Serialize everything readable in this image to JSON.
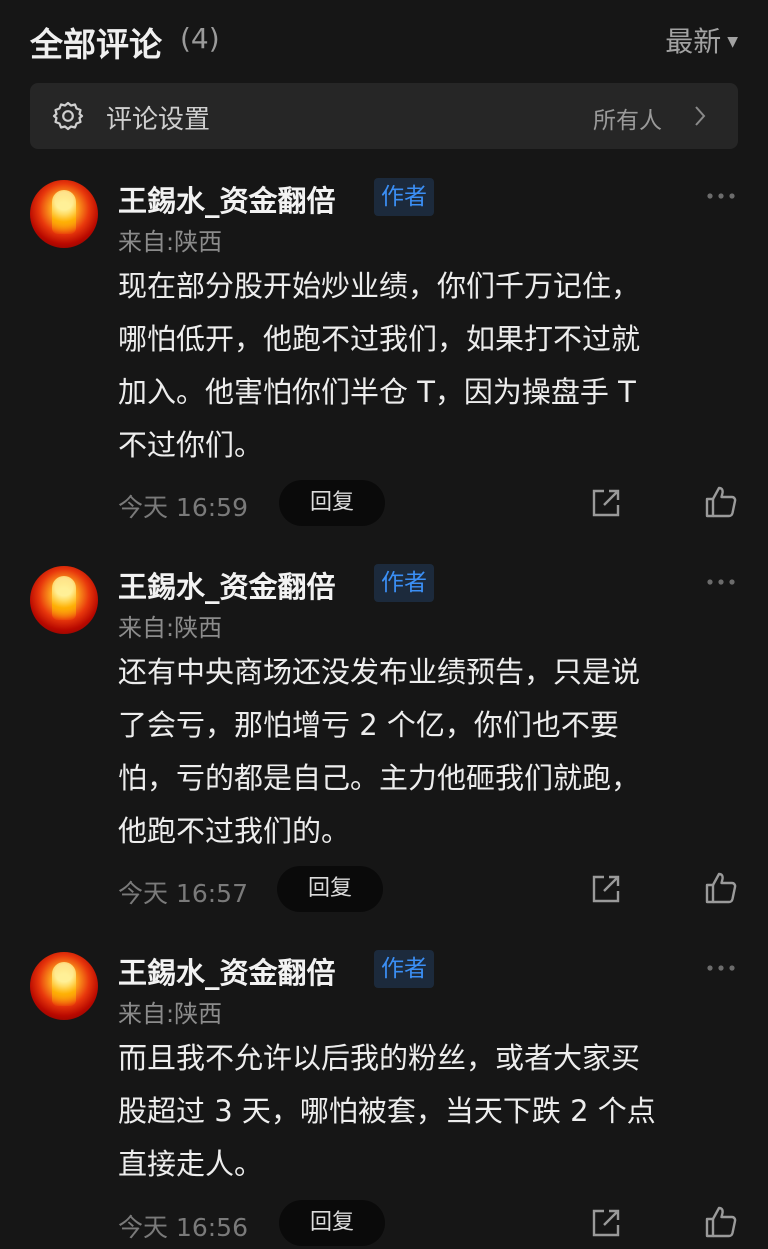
{
  "header": {
    "title": "全部评论",
    "count": "(4)",
    "sort_label": "最新",
    "sort_icon": "triangle-down-icon"
  },
  "settings": {
    "label": "评论设置",
    "value": "所有人",
    "icon": "gear-icon",
    "chevron_icon": "chevron-right-icon"
  },
  "comments": [
    {
      "author": "王錫水_资金翻倍",
      "badge": "作者",
      "location": "来自:陕西",
      "lines": [
        "现在部分股开始炒业绩，你们千万记住，",
        "哪怕低开，他跑不过我们，如果打不过就",
        "加入。他害怕你们半仓 T，因为操盘手 T",
        "不过你们。"
      ],
      "time": "今天 16:59",
      "reply_label": "回复"
    },
    {
      "author": "王錫水_资金翻倍",
      "badge": "作者",
      "location": "来自:陕西",
      "lines": [
        "还有中央商场还没发布业绩预告，只是说",
        "了会亏，那怕增亏 2 个亿，你们也不要",
        "怕，亏的都是自己。主力他砸我们就跑，",
        "他跑不过我们的。"
      ],
      "time": "今天 16:57",
      "reply_label": "回复"
    },
    {
      "author": "王錫水_资金翻倍",
      "badge": "作者",
      "location": "来自:陕西",
      "lines": [
        "而且我不允许以后我的粉丝，或者大家买",
        "股超过 3 天，哪怕被套，当天下跌 2 个点",
        "直接走人。"
      ],
      "time": "今天 16:56",
      "reply_label": "回复"
    }
  ],
  "colors": {
    "background": "#161616",
    "panel": "#262626",
    "badge_text": "#3b8ff5",
    "badge_bg": "#1c2a3c"
  }
}
